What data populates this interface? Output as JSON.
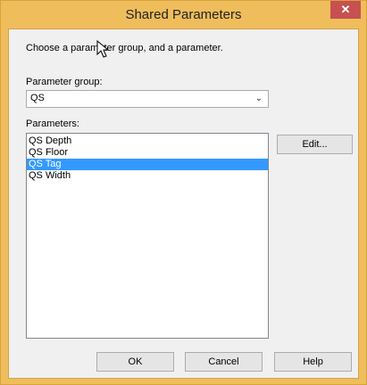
{
  "window": {
    "title": "Shared Parameters",
    "close_glyph": "✕"
  },
  "dialog": {
    "instruction": "Choose a parameter group, and a parameter.",
    "parameter_group_label": "Parameter group:",
    "parameter_group_value": "QS",
    "parameters_label": "Parameters:",
    "parameters": [
      {
        "label": "QS Depth",
        "selected": false
      },
      {
        "label": "QS Floor",
        "selected": false
      },
      {
        "label": "QS Tag",
        "selected": true
      },
      {
        "label": "QS Width",
        "selected": false
      }
    ],
    "edit_label": "Edit...",
    "ok_label": "OK",
    "cancel_label": "Cancel",
    "help_label": "Help"
  },
  "icons": {
    "dropdown": "chevron-down-icon",
    "close": "close-icon",
    "cursor": "mouse-cursor-icon"
  },
  "colors": {
    "titlebar": "#efbd5c",
    "close_button": "#c75050",
    "selection": "#3399ff"
  }
}
